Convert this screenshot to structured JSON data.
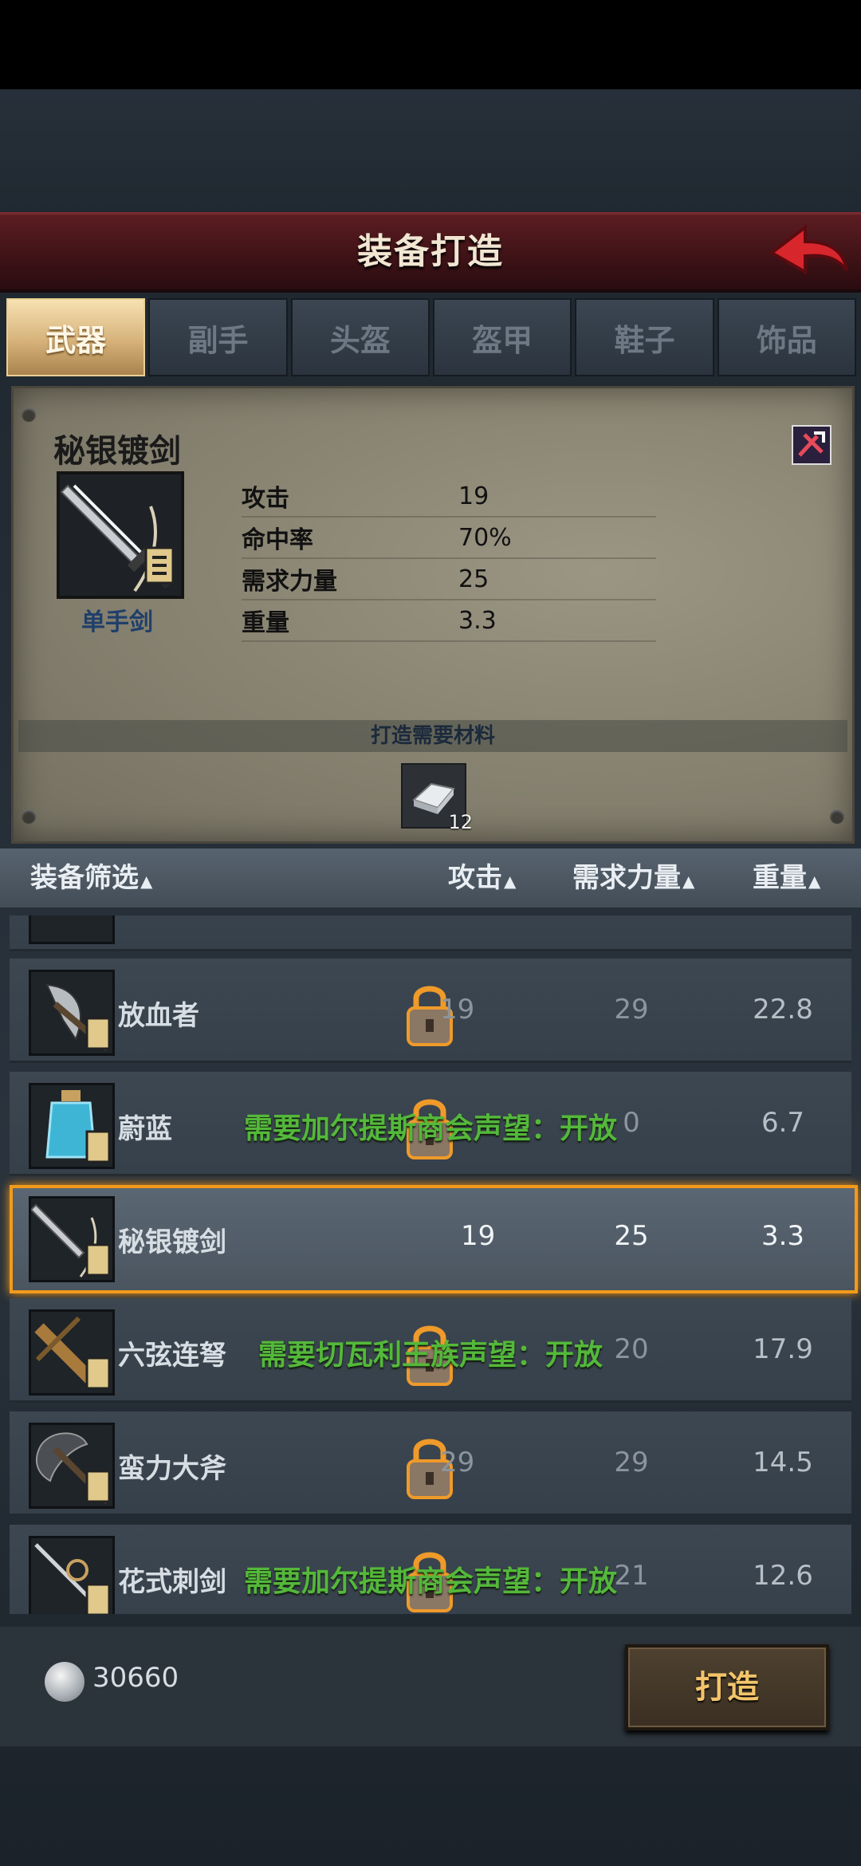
{
  "header": {
    "title": "装备打造"
  },
  "tabs": [
    {
      "label": "武器",
      "active": true
    },
    {
      "label": "副手",
      "active": false
    },
    {
      "label": "头盔",
      "active": false
    },
    {
      "label": "盔甲",
      "active": false
    },
    {
      "label": "鞋子",
      "active": false
    },
    {
      "label": "饰品",
      "active": false
    }
  ],
  "detail": {
    "name": "秘银镀剑",
    "type": "单手剑",
    "stats": [
      {
        "label": "攻击",
        "value": "19"
      },
      {
        "label": "命中率",
        "value": "70%"
      },
      {
        "label": "需求力量",
        "value": "25"
      },
      {
        "label": "重量",
        "value": "3.3"
      }
    ],
    "materials_title": "打造需要材料",
    "material_count": "12"
  },
  "list_header": {
    "filter": "装备筛选",
    "attack": "攻击",
    "strength": "需求力量",
    "weight": "重量",
    "sort_marker": "▲"
  },
  "rows": [
    {
      "name": "放血者",
      "attack": "19",
      "strength": "29",
      "weight": "22.8",
      "locked": true,
      "requirement": ""
    },
    {
      "name": "蔚蓝",
      "attack": "",
      "strength": "0",
      "weight": "6.7",
      "locked": true,
      "requirement": "需要加尔提斯商会声望：开放"
    },
    {
      "name": "秘银镀剑",
      "attack": "19",
      "strength": "25",
      "weight": "3.3",
      "locked": false,
      "selected": true,
      "requirement": ""
    },
    {
      "name": "六弦连弩",
      "attack": "",
      "strength": "20",
      "weight": "17.9",
      "locked": true,
      "requirement": "需要切瓦利王族声望：开放"
    },
    {
      "name": "蛮力大斧",
      "attack": "29",
      "strength": "29",
      "weight": "14.5",
      "locked": true,
      "requirement": ""
    },
    {
      "name": "花式刺剑",
      "attack": "",
      "strength": "21",
      "weight": "12.6",
      "locked": true,
      "requirement": "需要加尔提斯商会声望：开放"
    }
  ],
  "footer": {
    "money": "30660",
    "forge_label": "打造"
  },
  "colors": {
    "accent": "#f39a1b",
    "requirement": "#54b83a",
    "header": "#5c1d22",
    "tab_active": "#d6b27a"
  }
}
